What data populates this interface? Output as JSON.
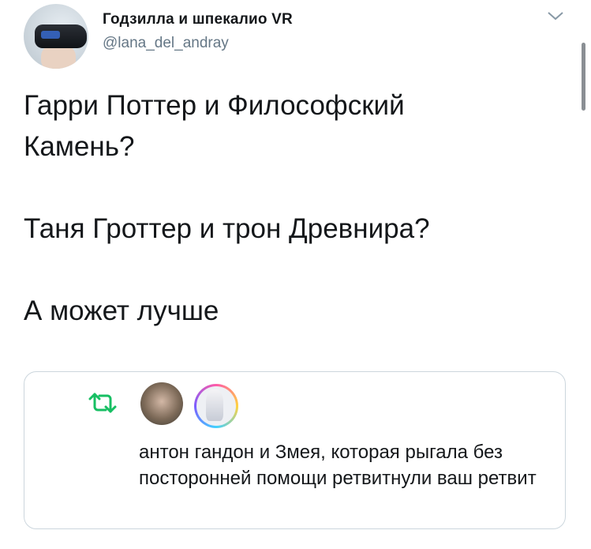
{
  "tweet": {
    "author": {
      "display_name": "Годзилла и шпекалио VR",
      "handle": "@lana_del_andray",
      "avatar_icon": "vr-headset-avatar"
    },
    "menu_icon": "chevron-down-icon",
    "lines": [
      "Гарри Поттер и Философский",
      "Камень?",
      "Таня Гроттер и трон Древнира?",
      "А может лучше"
    ]
  },
  "embedded_notification": {
    "icon": "retweet-icon",
    "accent_color": "#17bf63",
    "text": "антон гандон и Змея, которая рыгала без посторонней помощи ретвитнули ваш ретвит"
  }
}
